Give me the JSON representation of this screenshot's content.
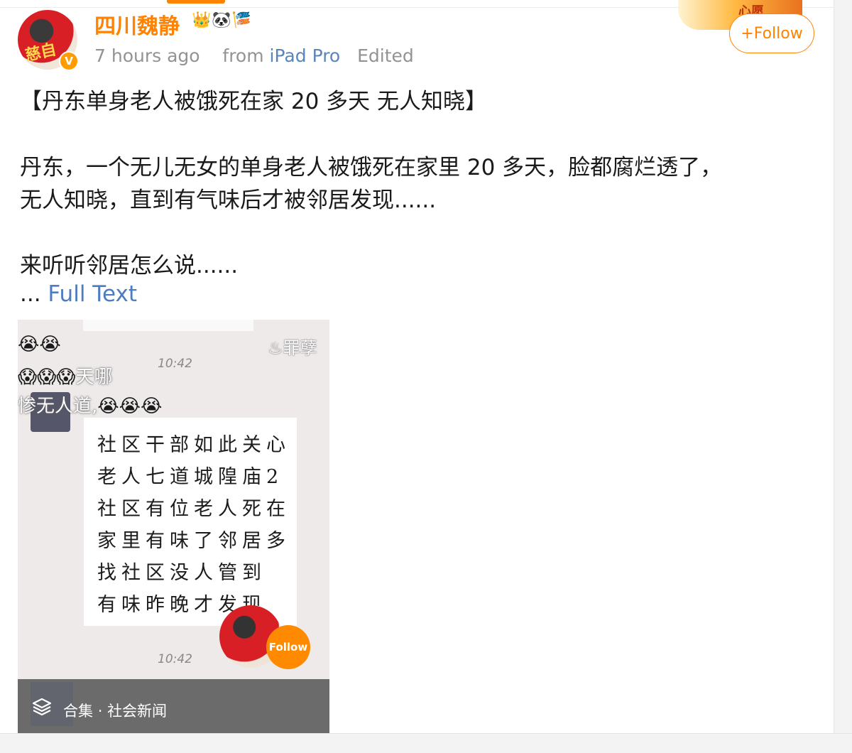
{
  "post": {
    "username": "四川魏静",
    "user_badges": "👑🐼🎏",
    "time": "7 hours ago",
    "from_label": "from",
    "source": "iPad Pro",
    "edited": "Edited",
    "avatar_text": "慈自",
    "verified_mark": "V",
    "follow_label": "+Follow",
    "banner_text": "心愿",
    "headline": "【丹东单身老人被饿死在家 20 多天 无人知晓】",
    "body_lines": [
      "丹东，一个无儿无女的单身老人被饿死在家里 20 多天，脸都腐烂透了，",
      "无人知晓，直到有气味后才被邻居发现......",
      "来听听邻居怎么说......"
    ],
    "more_prefix": "... ",
    "full_text_label": "Full Text"
  },
  "video": {
    "watermark": "罪孽",
    "chat_time_top": "10:42",
    "chat_time_bottom": "10:42",
    "danmu": [
      {
        "emojis": "😭😭",
        "text": ""
      },
      {
        "emojis": "😱😱😱",
        "text": "天哪"
      },
      {
        "emojis": "😭😭😭",
        "text": "惨无人道,"
      }
    ],
    "handwriting_lines": [
      "社区干部如此关心",
      "老人七道城隍庙2",
      "社区有位老人死在",
      "家里有味了邻居多",
      "找社区没人管到",
      "有味昨晚才发现"
    ],
    "overlay_follow": "Follow",
    "collection_label": "合集",
    "collection_sep": "·",
    "collection_name": "社会新闻"
  }
}
